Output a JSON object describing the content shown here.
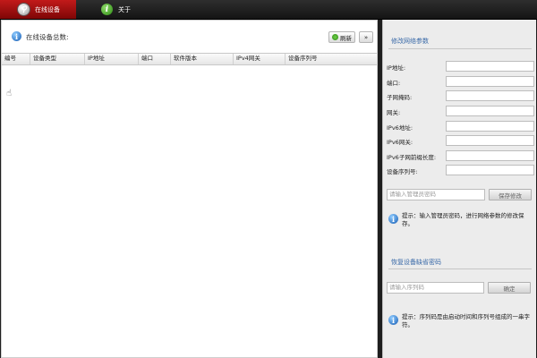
{
  "tabs": [
    {
      "label": "在线设备",
      "icon": "search-magnifier-icon",
      "active": true
    },
    {
      "label": "关于",
      "icon": "info-icon",
      "active": false
    }
  ],
  "device_list": {
    "title": "在线设备总数:",
    "refresh_label": "刷新",
    "more_label": "»",
    "columns": [
      "编号",
      "设备类型",
      "IP地址",
      "端口",
      "软件版本",
      "IPv4网关",
      "设备序列号"
    ],
    "rows": []
  },
  "network_params": {
    "title": "修改网络参数",
    "fields": [
      {
        "label": "IP地址:",
        "value": ""
      },
      {
        "label": "端口:",
        "value": ""
      },
      {
        "label": "子网掩码:",
        "value": ""
      },
      {
        "label": "网关:",
        "value": ""
      },
      {
        "label": "IPv6地址:",
        "value": ""
      },
      {
        "label": "IPv6网关:",
        "value": ""
      },
      {
        "label": "IPv6子网前缀长度:",
        "value": ""
      },
      {
        "label": "设备序列号:",
        "value": ""
      }
    ],
    "password_placeholder": "请输入管理员密码",
    "save_label": "保存修改",
    "hint": "提示：输入管理员密码，进行网络参数的修改保存。"
  },
  "restore_password": {
    "title": "恢复设备缺省密码",
    "serial_placeholder": "请输入序列码",
    "confirm_label": "确定",
    "hint": "提示：序列码是由启动时间和序列号组成的一串字符。"
  },
  "colors": {
    "accent_red": "#b01010",
    "title_blue": "#3a6aa8",
    "topbar": "#1e1e1e"
  }
}
